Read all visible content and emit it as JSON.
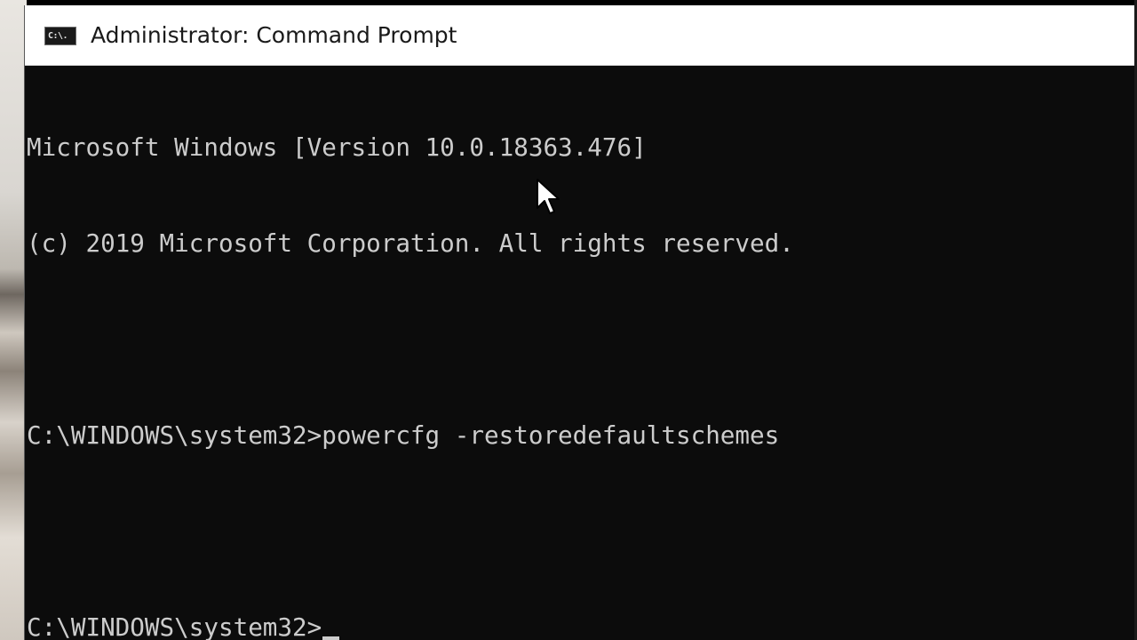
{
  "window": {
    "title": "Administrator: Command Prompt",
    "icon": "cmd-icon",
    "icon_text": "C:\\."
  },
  "console": {
    "lines": [
      "Microsoft Windows [Version 10.0.18363.476]",
      "(c) 2019 Microsoft Corporation. All rights reserved.",
      "",
      "C:\\WINDOWS\\system32>powercfg -restoredefaultschemes",
      "",
      "C:\\WINDOWS\\system32>"
    ]
  },
  "colors": {
    "console_bg": "#0c0c0c",
    "console_text": "#cccccc",
    "titlebar_bg": "#ffffff"
  },
  "pointer": "arrow-pointer-icon"
}
